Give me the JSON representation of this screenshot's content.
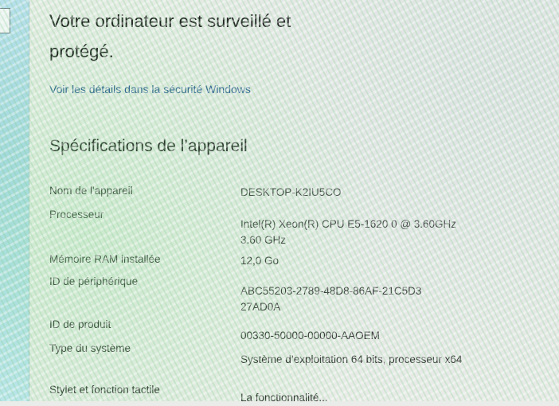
{
  "security": {
    "status_text": "Votre ordinateur est surveillé et protégé.",
    "details_link": "Voir les détails dans la sécurité Windows"
  },
  "specs": {
    "heading": "Spécifications de l’appareil",
    "rows": [
      {
        "label": "Nom de l'appareil",
        "value": "DESKTOP-K2IU5CO"
      },
      {
        "label": "Processeur",
        "value": "Intel(R) Xeon(R) CPU E5-1620 0 @ 3.60GHz   3.60 GHz"
      },
      {
        "label": "Mémoire RAM installée",
        "value": "12,0 Go"
      },
      {
        "label": "ID de périphérique",
        "value": "ABC55203-2789-48D8-86AF-21C5D3 27AD0A"
      },
      {
        "label": "ID de produit",
        "value": "00330-50000-00000-AAOEM"
      },
      {
        "label": "Type du système",
        "value": "Système d’exploitation 64 bits, processeur x64"
      },
      {
        "label": "Stylet et fonction tactile",
        "value": "La fonctionnalité..."
      }
    ]
  }
}
